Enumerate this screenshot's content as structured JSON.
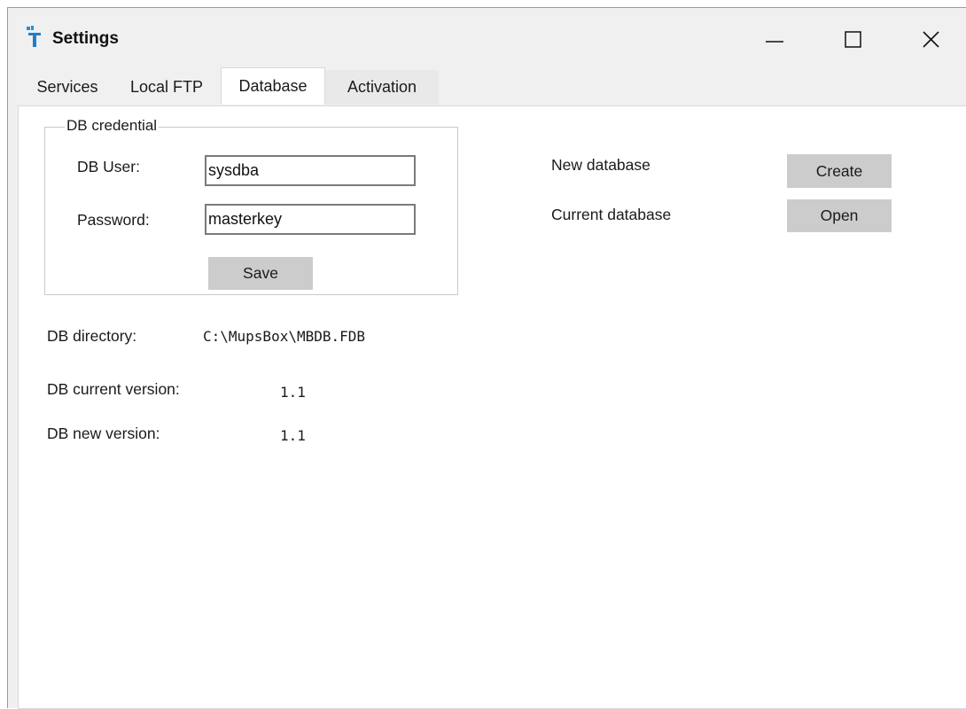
{
  "window": {
    "title": "Settings",
    "app_icon": "app-icon",
    "controls": [
      "minimize-icon",
      "maximize-icon",
      "close-icon"
    ]
  },
  "tabs": [
    {
      "label": "Services",
      "selected": false
    },
    {
      "label": "Local FTP",
      "selected": false
    },
    {
      "label": "Database",
      "selected": true
    },
    {
      "label": "Activation",
      "selected": false
    }
  ],
  "credentials": {
    "legend": "DB credential",
    "user_label": "DB User:",
    "user_value": "sysdba",
    "password_label": "Password:",
    "password_value": "masterkey",
    "save_label": "Save"
  },
  "info": {
    "directory_label": "DB directory:",
    "directory_value": "C:\\MupsBox\\MBDB.FDB",
    "current_version_label": "DB current version:",
    "current_version_value": "1.1",
    "new_version_label": "DB new version:",
    "new_version_value": "1.1"
  },
  "actions": {
    "new_db_label": "New database",
    "create_label": "Create",
    "current_db_label": "Current database",
    "open_label": "Open"
  }
}
